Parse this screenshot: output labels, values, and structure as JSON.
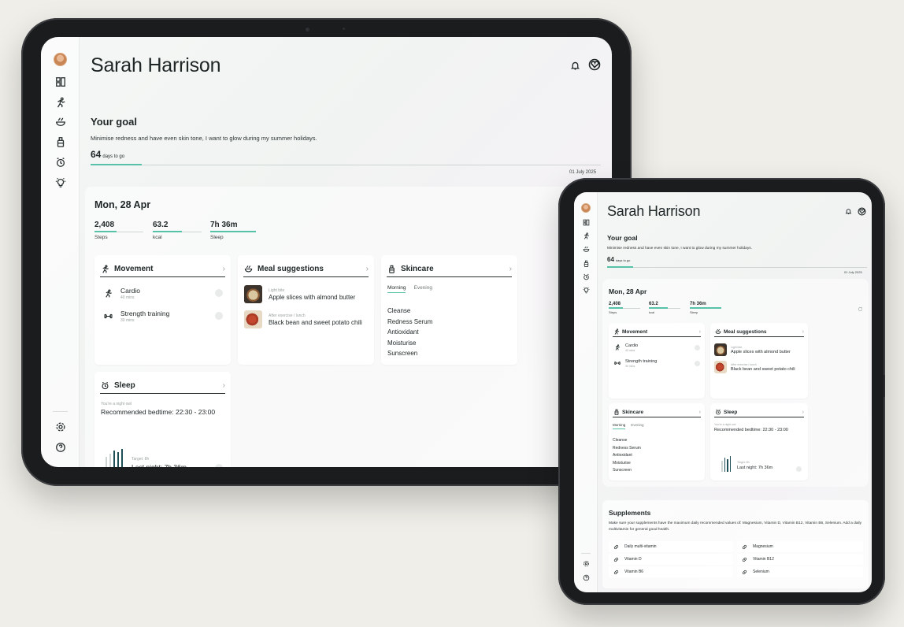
{
  "user": {
    "name": "Sarah Harrison"
  },
  "goal": {
    "heading": "Your goal",
    "text": "Minimise redness and have even skin tone, I want to glow during my summer holidays.",
    "days": "64",
    "days_label": "days to go",
    "progress": 0.1,
    "target_date": "01 July 2025"
  },
  "day": {
    "date": "Mon, 28 Apr",
    "stats": [
      {
        "value": "2,408",
        "label": "Steps",
        "progress": 0.45
      },
      {
        "value": "63.2",
        "label": "kcal",
        "progress": 0.6
      },
      {
        "value": "7h 36m",
        "label": "Sleep",
        "progress": 1.0
      }
    ]
  },
  "movement": {
    "title": "Movement",
    "items": [
      {
        "name": "Cardio",
        "duration": "40 mins"
      },
      {
        "name": "Strength training",
        "duration": "30 mins"
      }
    ]
  },
  "meals": {
    "title": "Meal suggestions",
    "items": [
      {
        "tag": "Light bite",
        "name": "Apple slices with almond butter"
      },
      {
        "tag": "After exercise / lunch",
        "name": "Black bean and sweet potato chili"
      }
    ]
  },
  "skincare": {
    "title": "Skincare",
    "tabs": [
      "Morning",
      "Evening"
    ],
    "active_tab": "Morning",
    "steps": [
      "Cleanse",
      "Redness Serum",
      "Antioxidant",
      "Moisturise",
      "Sunscreen"
    ]
  },
  "sleep": {
    "title": "Sleep",
    "note": "You're a night owl",
    "bedtime": "Recommended bedtime: 22:30 - 23:00",
    "target": "Target: 8h",
    "last_night": "Last night: 7h 36m"
  },
  "supplements": {
    "title": "Supplements",
    "text": "Make sure your supplements have the maximum daily recommended values of: Magnesium, Vitamin D, Vitamin B12, Vitamin B6, Selenium. Add a daily multivitamin for general good health.",
    "items": [
      "Daily multi-vitamin",
      "Magnesium",
      "Vitamin D",
      "Vitamin B12",
      "Vitamin B6",
      "Selenium"
    ]
  },
  "icons": {
    "sidebar": [
      "avatar",
      "dashboard-icon",
      "movement-icon",
      "meal-icon",
      "skincare-icon",
      "sleep-icon",
      "idea-icon"
    ],
    "sidebar_bottom": [
      "settings-icon",
      "help-icon"
    ],
    "header": [
      "bell-icon",
      "location-icon"
    ],
    "accent_color": "#58c2a9",
    "dark_teal": "#1e4f57"
  }
}
